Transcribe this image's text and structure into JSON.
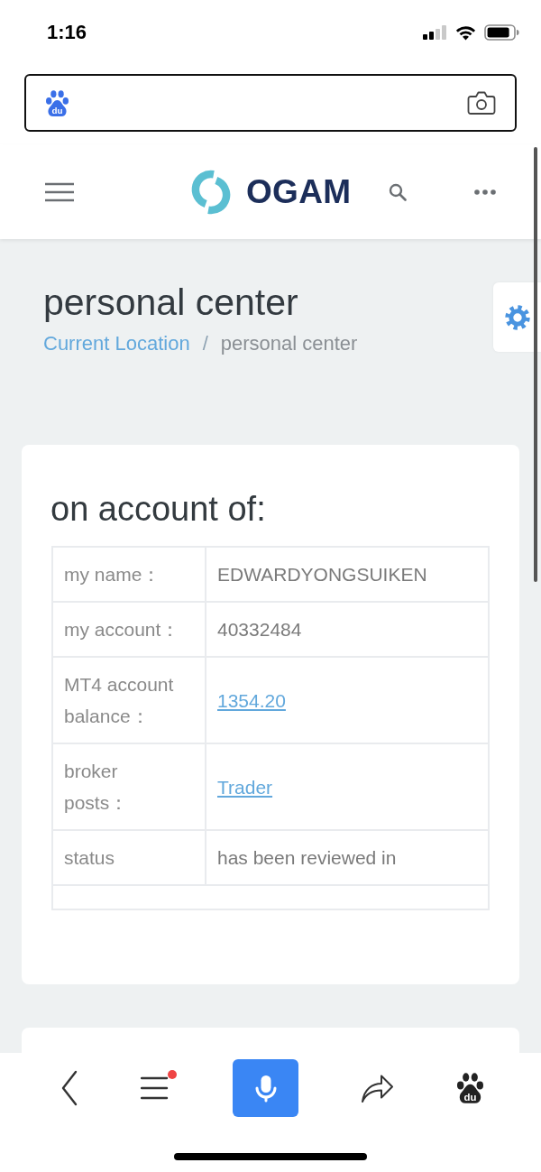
{
  "status_bar": {
    "time": "1:16"
  },
  "browser_bar": {
    "logo_text": "du"
  },
  "header": {
    "brand": "OGAM"
  },
  "page_heading": {
    "title": "personal center",
    "breadcrumb": [
      {
        "label": "Current Location",
        "kind": "link"
      },
      {
        "label": "personal center",
        "kind": "current"
      }
    ],
    "separator": "/"
  },
  "account_card": {
    "title": "on account of:",
    "rows": [
      {
        "label": "my name：",
        "value": "EDWARDYONGSUIKEN",
        "kind": "text"
      },
      {
        "label": "my account：",
        "value": "40332484",
        "kind": "text"
      },
      {
        "label": "MT4 account balance：",
        "value": "1354.20",
        "kind": "link"
      },
      {
        "label": "broker posts：",
        "value": "Trader",
        "kind": "link"
      },
      {
        "label": "status",
        "value": "has been reviewed in",
        "kind": "text"
      }
    ],
    "empty_footer_row": true
  },
  "bottom_bar": {
    "menu_badge": true,
    "logo_text": "du"
  }
}
